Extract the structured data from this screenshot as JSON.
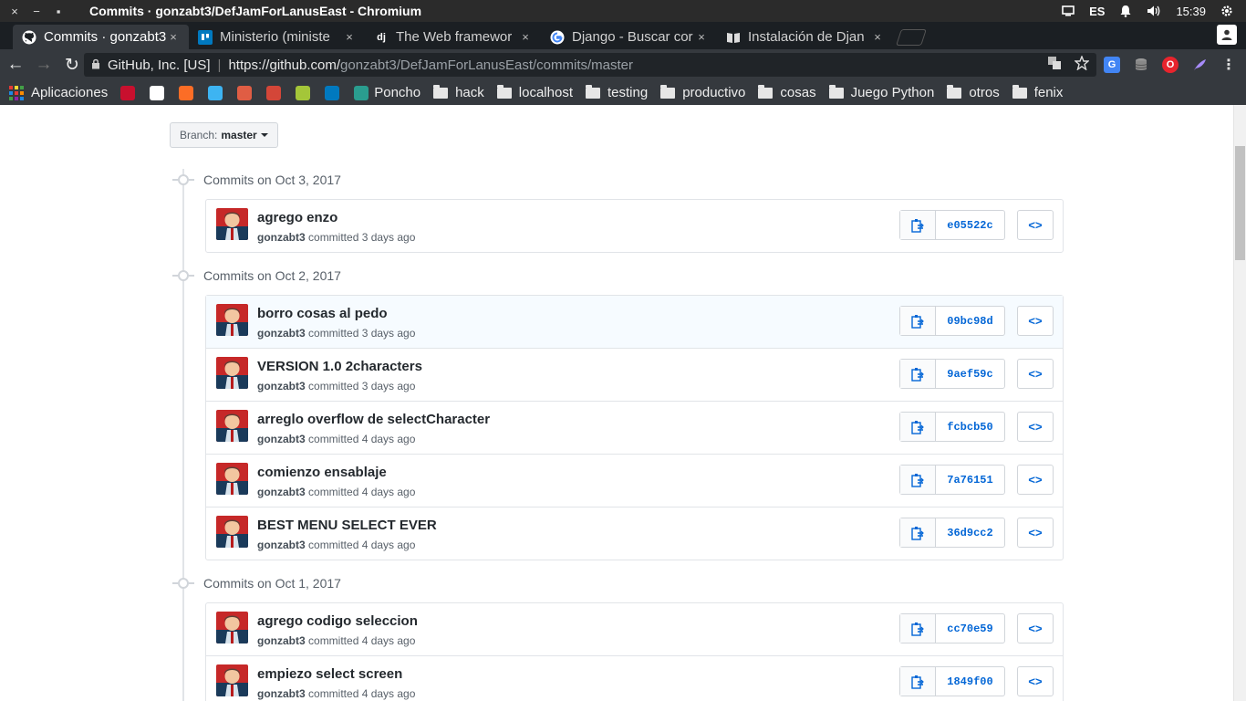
{
  "os_bar": {
    "close_icon": "×",
    "minimize_icon": "−",
    "maximize_icon": "▪",
    "window_title": "Commits · gonzabt3/DefJamForLanusEast - Chromium",
    "keyboard": "ES",
    "time": "15:39"
  },
  "tabs": [
    {
      "title": "Commits · gonzabt3",
      "icon": "github-icon",
      "active": true
    },
    {
      "title": "Ministerio (ministe",
      "icon": "trello-icon",
      "active": false
    },
    {
      "title": "The Web framewor",
      "icon": "django-icon",
      "active": false
    },
    {
      "title": "Django - Buscar cor",
      "icon": "google-icon",
      "active": false
    },
    {
      "title": "Instalación de Djan",
      "icon": "book-icon",
      "active": false
    }
  ],
  "tab_close": "×",
  "toolbar": {
    "back": "←",
    "forward": "→",
    "reload": "↻",
    "site_org": "GitHub, Inc. [US]",
    "url_host": "https://github.com/",
    "url_path": "gonzabt3/DefJamForLanusEast/commits/master"
  },
  "bookmarks": [
    {
      "label": "Aplicaciones",
      "type": "apps"
    },
    {
      "label": "",
      "type": "icon",
      "color": "#c8102e"
    },
    {
      "label": "",
      "type": "icon",
      "color": "#ffffff"
    },
    {
      "label": "",
      "type": "icon",
      "color": "#fc6d26"
    },
    {
      "label": "",
      "type": "icon",
      "color": "#3db4f2"
    },
    {
      "label": "",
      "type": "icon",
      "color": "#e05d44"
    },
    {
      "label": "",
      "type": "icon",
      "color": "#d44638"
    },
    {
      "label": "",
      "type": "icon",
      "color": "#a4c639"
    },
    {
      "label": "",
      "type": "icon",
      "color": "#0079bf"
    },
    {
      "label": "Poncho",
      "type": "icon",
      "color": "#2a9d8f"
    },
    {
      "label": "hack",
      "type": "folder"
    },
    {
      "label": "localhost",
      "type": "folder"
    },
    {
      "label": "testing",
      "type": "folder"
    },
    {
      "label": "productivo",
      "type": "folder"
    },
    {
      "label": "cosas",
      "type": "folder"
    },
    {
      "label": "Juego Python",
      "type": "folder"
    },
    {
      "label": "otros",
      "type": "folder"
    },
    {
      "label": "fenix",
      "type": "folder"
    }
  ],
  "branch": {
    "label": "Branch:",
    "value": "master"
  },
  "groups": [
    {
      "heading": "Commits on Oct 3, 2017",
      "commits": [
        {
          "message": "agrego enzo",
          "author": "gonzabt3",
          "time": "committed 3 days ago",
          "sha": "e05522c"
        }
      ]
    },
    {
      "heading": "Commits on Oct 2, 2017",
      "commits": [
        {
          "message": "borro cosas al pedo",
          "author": "gonzabt3",
          "time": "committed 3 days ago",
          "sha": "09bc98d"
        },
        {
          "message": "VERSION 1.0 2characters",
          "author": "gonzabt3",
          "time": "committed 3 days ago",
          "sha": "9aef59c"
        },
        {
          "message": "arreglo overflow de selectCharacter",
          "author": "gonzabt3",
          "time": "committed 4 days ago",
          "sha": "fcbcb50"
        },
        {
          "message": "comienzo ensablaje",
          "author": "gonzabt3",
          "time": "committed 4 days ago",
          "sha": "7a76151"
        },
        {
          "message": "BEST MENU SELECT EVER",
          "author": "gonzabt3",
          "time": "committed 4 days ago",
          "sha": "36d9cc2"
        }
      ]
    },
    {
      "heading": "Commits on Oct 1, 2017",
      "commits": [
        {
          "message": "agrego codigo seleccion",
          "author": "gonzabt3",
          "time": "committed 4 days ago",
          "sha": "cc70e59"
        },
        {
          "message": "empiezo select screen",
          "author": "gonzabt3",
          "time": "committed 4 days ago",
          "sha": "1849f00"
        }
      ]
    }
  ],
  "browse_label": "<>",
  "colors": {
    "link": "#0366d6",
    "text": "#24292e",
    "muted": "#586069",
    "highlight_row": "#f6fbff"
  }
}
